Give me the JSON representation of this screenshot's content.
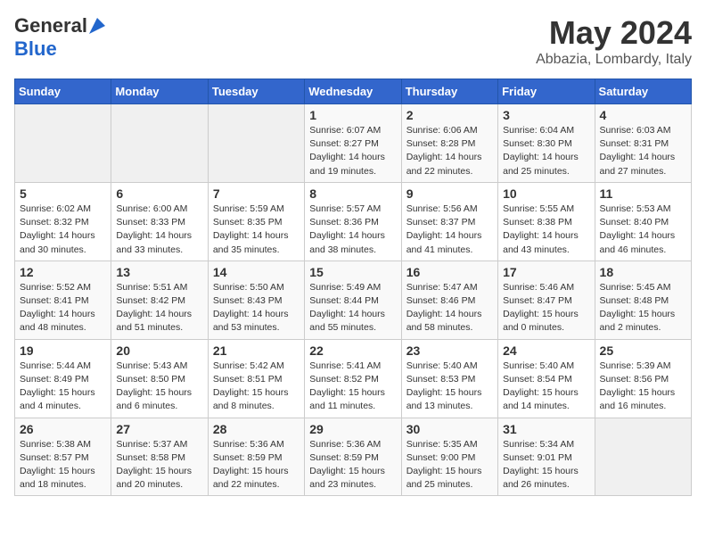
{
  "header": {
    "logo_general": "General",
    "logo_blue": "Blue",
    "month_title": "May 2024",
    "location": "Abbazia, Lombardy, Italy"
  },
  "days_of_week": [
    "Sunday",
    "Monday",
    "Tuesday",
    "Wednesday",
    "Thursday",
    "Friday",
    "Saturday"
  ],
  "weeks": [
    [
      {
        "day": "",
        "text": ""
      },
      {
        "day": "",
        "text": ""
      },
      {
        "day": "",
        "text": ""
      },
      {
        "day": "1",
        "text": "Sunrise: 6:07 AM\nSunset: 8:27 PM\nDaylight: 14 hours\nand 19 minutes."
      },
      {
        "day": "2",
        "text": "Sunrise: 6:06 AM\nSunset: 8:28 PM\nDaylight: 14 hours\nand 22 minutes."
      },
      {
        "day": "3",
        "text": "Sunrise: 6:04 AM\nSunset: 8:30 PM\nDaylight: 14 hours\nand 25 minutes."
      },
      {
        "day": "4",
        "text": "Sunrise: 6:03 AM\nSunset: 8:31 PM\nDaylight: 14 hours\nand 27 minutes."
      }
    ],
    [
      {
        "day": "5",
        "text": "Sunrise: 6:02 AM\nSunset: 8:32 PM\nDaylight: 14 hours\nand 30 minutes."
      },
      {
        "day": "6",
        "text": "Sunrise: 6:00 AM\nSunset: 8:33 PM\nDaylight: 14 hours\nand 33 minutes."
      },
      {
        "day": "7",
        "text": "Sunrise: 5:59 AM\nSunset: 8:35 PM\nDaylight: 14 hours\nand 35 minutes."
      },
      {
        "day": "8",
        "text": "Sunrise: 5:57 AM\nSunset: 8:36 PM\nDaylight: 14 hours\nand 38 minutes."
      },
      {
        "day": "9",
        "text": "Sunrise: 5:56 AM\nSunset: 8:37 PM\nDaylight: 14 hours\nand 41 minutes."
      },
      {
        "day": "10",
        "text": "Sunrise: 5:55 AM\nSunset: 8:38 PM\nDaylight: 14 hours\nand 43 minutes."
      },
      {
        "day": "11",
        "text": "Sunrise: 5:53 AM\nSunset: 8:40 PM\nDaylight: 14 hours\nand 46 minutes."
      }
    ],
    [
      {
        "day": "12",
        "text": "Sunrise: 5:52 AM\nSunset: 8:41 PM\nDaylight: 14 hours\nand 48 minutes."
      },
      {
        "day": "13",
        "text": "Sunrise: 5:51 AM\nSunset: 8:42 PM\nDaylight: 14 hours\nand 51 minutes."
      },
      {
        "day": "14",
        "text": "Sunrise: 5:50 AM\nSunset: 8:43 PM\nDaylight: 14 hours\nand 53 minutes."
      },
      {
        "day": "15",
        "text": "Sunrise: 5:49 AM\nSunset: 8:44 PM\nDaylight: 14 hours\nand 55 minutes."
      },
      {
        "day": "16",
        "text": "Sunrise: 5:47 AM\nSunset: 8:46 PM\nDaylight: 14 hours\nand 58 minutes."
      },
      {
        "day": "17",
        "text": "Sunrise: 5:46 AM\nSunset: 8:47 PM\nDaylight: 15 hours\nand 0 minutes."
      },
      {
        "day": "18",
        "text": "Sunrise: 5:45 AM\nSunset: 8:48 PM\nDaylight: 15 hours\nand 2 minutes."
      }
    ],
    [
      {
        "day": "19",
        "text": "Sunrise: 5:44 AM\nSunset: 8:49 PM\nDaylight: 15 hours\nand 4 minutes."
      },
      {
        "day": "20",
        "text": "Sunrise: 5:43 AM\nSunset: 8:50 PM\nDaylight: 15 hours\nand 6 minutes."
      },
      {
        "day": "21",
        "text": "Sunrise: 5:42 AM\nSunset: 8:51 PM\nDaylight: 15 hours\nand 8 minutes."
      },
      {
        "day": "22",
        "text": "Sunrise: 5:41 AM\nSunset: 8:52 PM\nDaylight: 15 hours\nand 11 minutes."
      },
      {
        "day": "23",
        "text": "Sunrise: 5:40 AM\nSunset: 8:53 PM\nDaylight: 15 hours\nand 13 minutes."
      },
      {
        "day": "24",
        "text": "Sunrise: 5:40 AM\nSunset: 8:54 PM\nDaylight: 15 hours\nand 14 minutes."
      },
      {
        "day": "25",
        "text": "Sunrise: 5:39 AM\nSunset: 8:56 PM\nDaylight: 15 hours\nand 16 minutes."
      }
    ],
    [
      {
        "day": "26",
        "text": "Sunrise: 5:38 AM\nSunset: 8:57 PM\nDaylight: 15 hours\nand 18 minutes."
      },
      {
        "day": "27",
        "text": "Sunrise: 5:37 AM\nSunset: 8:58 PM\nDaylight: 15 hours\nand 20 minutes."
      },
      {
        "day": "28",
        "text": "Sunrise: 5:36 AM\nSunset: 8:59 PM\nDaylight: 15 hours\nand 22 minutes."
      },
      {
        "day": "29",
        "text": "Sunrise: 5:36 AM\nSunset: 8:59 PM\nDaylight: 15 hours\nand 23 minutes."
      },
      {
        "day": "30",
        "text": "Sunrise: 5:35 AM\nSunset: 9:00 PM\nDaylight: 15 hours\nand 25 minutes."
      },
      {
        "day": "31",
        "text": "Sunrise: 5:34 AM\nSunset: 9:01 PM\nDaylight: 15 hours\nand 26 minutes."
      },
      {
        "day": "",
        "text": ""
      }
    ]
  ]
}
